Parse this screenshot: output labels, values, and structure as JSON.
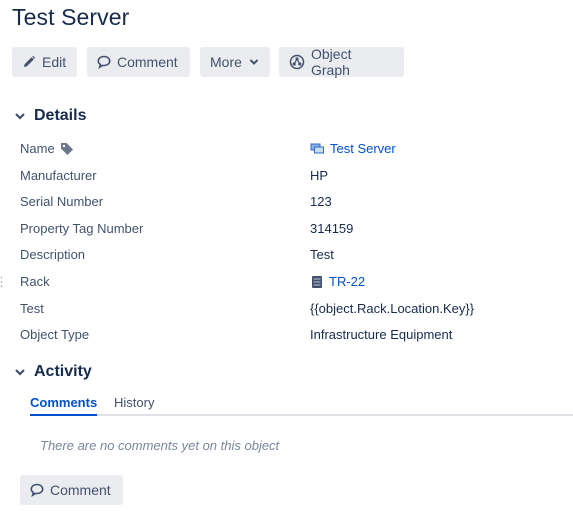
{
  "page": {
    "title": "Test Server"
  },
  "toolbar": {
    "edit_label": "Edit",
    "comment_label": "Comment",
    "more_label": "More",
    "graph_label": "Object Graph"
  },
  "details": {
    "heading": "Details",
    "rows": [
      {
        "label": "Name",
        "value": "Test Server"
      },
      {
        "label": "Manufacturer",
        "value": "HP"
      },
      {
        "label": "Serial Number",
        "value": "123"
      },
      {
        "label": "Property Tag Number",
        "value": "314159"
      },
      {
        "label": "Description",
        "value": "Test"
      },
      {
        "label": "Rack",
        "value": "TR-22"
      },
      {
        "label": "Test",
        "value": "{{object.Rack.Location.Key}}"
      },
      {
        "label": "Object Type",
        "value": "Infrastructure Equipment"
      }
    ]
  },
  "activity": {
    "heading": "Activity",
    "tabs": [
      {
        "label": "Comments",
        "active": true
      },
      {
        "label": "History",
        "active": false
      }
    ],
    "empty_text": "There are no comments yet on this object",
    "comment_button_label": "Comment"
  },
  "icons": {
    "edit": "pencil-icon",
    "comment": "speech-bubble-icon",
    "more": "chevron-down-icon",
    "graph": "graph-icon",
    "collapse": "chevron-down-icon",
    "name_tag": "tag-icon",
    "name_object": "object-icon",
    "rack": "server-rack-icon"
  },
  "colors": {
    "link": "#0052cc",
    "button_bg": "#ebecf0",
    "text": "#172b4d",
    "muted": "#42526e"
  }
}
